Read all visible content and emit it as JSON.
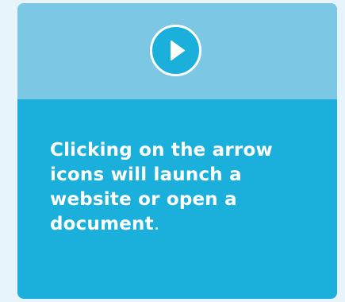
{
  "card": {
    "header": {
      "button_icon": "play-icon",
      "header_color": "#7cc7e3"
    },
    "body": {
      "text": "Clicking on the arrow icons will launch a website or open a document",
      "end_punctuation": ".",
      "body_color": "#1bb0db",
      "text_color": "#ffffff"
    }
  }
}
